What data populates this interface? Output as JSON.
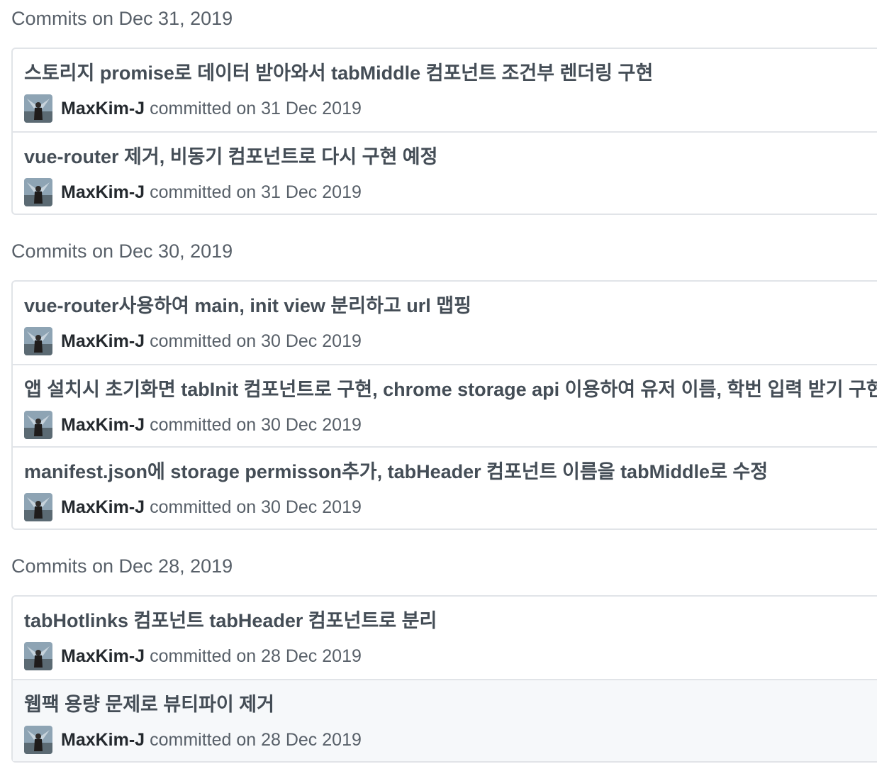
{
  "groups": [
    {
      "heading": "Commits on Dec 31, 2019",
      "commits": [
        {
          "title": "스토리지 promise로 데이터 받아와서 tabMiddle 컴포넌트 조건부 렌더링 구현",
          "author": "MaxKim-J",
          "committed": "committed on 31 Dec 2019"
        },
        {
          "title": "vue-router 제거, 비동기 컴포넌트로 다시 구현 예정",
          "author": "MaxKim-J",
          "committed": "committed on 31 Dec 2019"
        }
      ]
    },
    {
      "heading": "Commits on Dec 30, 2019",
      "commits": [
        {
          "title": "vue-router사용하여 main, init view 분리하고 url 맵핑",
          "author": "MaxKim-J",
          "committed": "committed on 30 Dec 2019"
        },
        {
          "title": "앱 설치시 초기화면 tabInit 컴포넌트로 구현, chrome storage api 이용하여 유저 이름, 학번 입력 받기 구현",
          "author": "MaxKim-J",
          "committed": "committed on 30 Dec 2019"
        },
        {
          "title": "manifest.json에 storage permisson추가, tabHeader 컴포넌트 이름을 tabMiddle로 수정",
          "author": "MaxKim-J",
          "committed": "committed on 30 Dec 2019"
        }
      ]
    },
    {
      "heading": "Commits on Dec 28, 2019",
      "commits": [
        {
          "title": "tabHotlinks 컴포넌트 tabHeader 컴포넌트로 분리",
          "author": "MaxKim-J",
          "committed": "committed on 28 Dec 2019"
        },
        {
          "title": "웹팩 용량 문제로 뷰티파이 제거",
          "author": "MaxKim-J",
          "committed": "committed on 28 Dec 2019",
          "hovered": true
        }
      ]
    }
  ],
  "colors": {
    "heading": "#586069",
    "title": "#444d56",
    "author": "#24292e",
    "border": "#e1e4e8",
    "hover_bg": "#f6f8fa"
  },
  "icons": {
    "avatar": "user-avatar-icon"
  }
}
